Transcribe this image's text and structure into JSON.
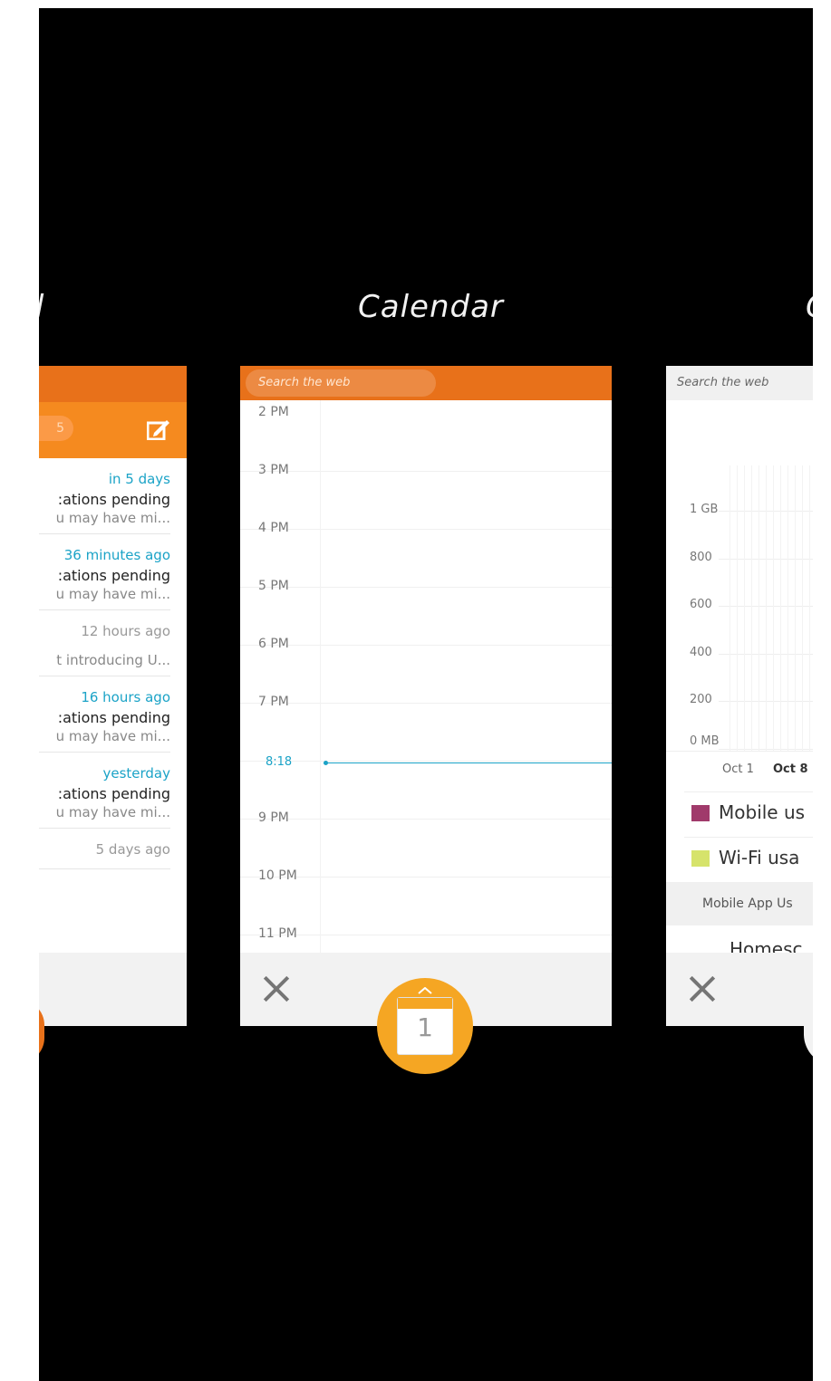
{
  "cards": {
    "left": {
      "title_fragment": "l",
      "badge": "5",
      "items": [
        {
          "time": "in 5 days",
          "time_accent": true,
          "subject": ":ations pending",
          "preview": "u may have mi..."
        },
        {
          "time": "36 minutes ago",
          "time_accent": true,
          "subject": ":ations pending",
          "preview": "u may have mi..."
        },
        {
          "time": "12 hours ago",
          "time_accent": false,
          "subject": "",
          "preview": "t introducing U..."
        },
        {
          "time": "16 hours ago",
          "time_accent": true,
          "subject": ":ations pending",
          "preview": "u may have mi..."
        },
        {
          "time": "yesterday",
          "time_accent": true,
          "subject": ":ations pending",
          "preview": "u may have mi..."
        },
        {
          "time": "5 days ago",
          "time_accent": false,
          "subject": "",
          "preview": ""
        }
      ]
    },
    "calendar": {
      "title": "Calendar",
      "search_placeholder": "Search the web",
      "hours": [
        "2 PM",
        "3 PM",
        "4 PM",
        "5 PM",
        "6 PM",
        "7 PM",
        "",
        "9 PM",
        "10 PM",
        "11 PM"
      ],
      "current_time": "8:18",
      "app_icon_day": "1"
    },
    "usage": {
      "title_fragment": "C",
      "search_placeholder": "Search the web",
      "y_labels": [
        "1 GB",
        "800",
        "600",
        "400",
        "200",
        "0 MB"
      ],
      "x_labels": [
        "Oct 1",
        "Oct 8"
      ],
      "legend": [
        {
          "label": "Mobile us",
          "color": "#a03a6b"
        },
        {
          "label": "Wi-Fi usa",
          "color": "#d6e36b"
        }
      ],
      "section_label": "Mobile App Us",
      "list_item": "Homesc"
    }
  },
  "colors": {
    "accent_orange": "#e8711a",
    "header_orange": "#f58a1f",
    "fab_orange": "#f5a623",
    "time_blue": "#1ba3c7"
  }
}
